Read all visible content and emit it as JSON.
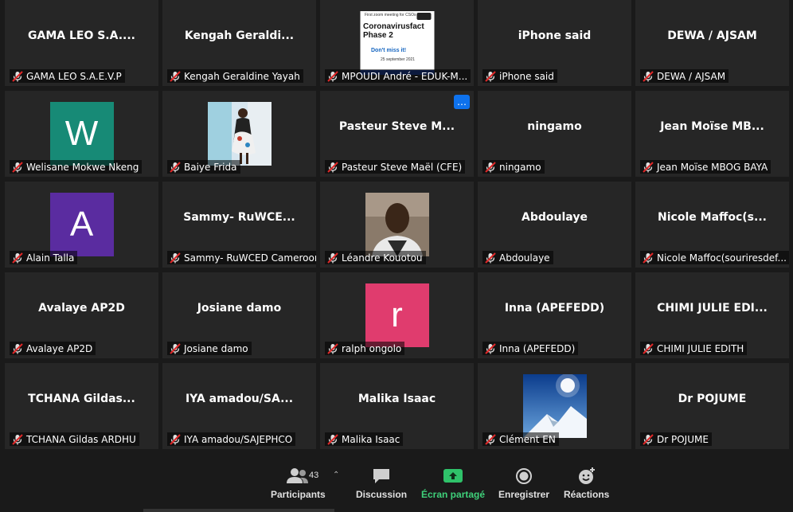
{
  "participants": [
    {
      "center": "GAMA LEO S.A....",
      "label": "GAMA LEO S.A.E.V.P",
      "kind": "name"
    },
    {
      "center": "Kengah Geraldi...",
      "label": "Kengah Geraldine Yayah",
      "kind": "name"
    },
    {
      "center": "",
      "label": "MPOUDI André - EDUK-M...",
      "kind": "shared"
    },
    {
      "center": "iPhone said",
      "label": "iPhone said",
      "kind": "name"
    },
    {
      "center": "DEWA / AJSAM",
      "label": "DEWA / AJSAM",
      "kind": "name"
    },
    {
      "center": "W",
      "label": "Welisane Mokwe Nkeng",
      "kind": "avatar",
      "color": "#178a76"
    },
    {
      "center": "",
      "label": "Baiye Frida",
      "kind": "photo-woman"
    },
    {
      "center": "Pasteur Steve M...",
      "label": "Pasteur Steve Maël (CFE)",
      "kind": "name",
      "more": true
    },
    {
      "center": "ningamo",
      "label": "ningamo",
      "kind": "name"
    },
    {
      "center": "Jean Moïse MB...",
      "label": "Jean Moïse MBOG BAYA",
      "kind": "name"
    },
    {
      "center": "A",
      "label": "Alain Talla",
      "kind": "avatar",
      "color": "#5a2ca0"
    },
    {
      "center": "Sammy- RuWCE...",
      "label": "Sammy- RuWCED Cameroon",
      "kind": "name"
    },
    {
      "center": "",
      "label": "Léandre Kouotou",
      "kind": "photo-man"
    },
    {
      "center": "Abdoulaye",
      "label": "Abdoulaye",
      "kind": "name"
    },
    {
      "center": "Nicole Maffoc(s...",
      "label": "Nicole Maffoc(souriresdef...",
      "kind": "name"
    },
    {
      "center": "Avalaye AP2D",
      "label": "Avalaye AP2D",
      "kind": "name"
    },
    {
      "center": "Josiane damo",
      "label": "Josiane damo",
      "kind": "name"
    },
    {
      "center": "r",
      "label": "ralph ongolo",
      "kind": "avatar",
      "color": "#e03c6e"
    },
    {
      "center": "Inna (APEFEDD)",
      "label": "Inna (APEFEDD)",
      "kind": "name"
    },
    {
      "center": "CHIMI JULIE EDI...",
      "label": "CHIMI JULIE EDITH",
      "kind": "name"
    },
    {
      "center": "TCHANA Gildas...",
      "label": "TCHANA Gildas ARDHU",
      "kind": "name"
    },
    {
      "center": "IYA amadou/SA...",
      "label": "IYA amadou/SAJEPHCO",
      "kind": "name"
    },
    {
      "center": "Malika Isaac",
      "label": "Malika Isaac",
      "kind": "name"
    },
    {
      "center": "",
      "label": "Clément EN",
      "kind": "photo-mountain"
    },
    {
      "center": "Dr POJUME",
      "label": "Dr POJUME",
      "kind": "name"
    }
  ],
  "shared_thumb": {
    "small": "First zoom meeting for CSOs",
    "title": "Coronavirusfact Phase 2",
    "sub": "Don't miss it!",
    "date": "25 september 2021"
  },
  "toolbar": {
    "participants_label": "Participants",
    "participants_count": "43",
    "discussion_label": "Discussion",
    "share_label": "Écran partagé",
    "record_label": "Enregistrer",
    "reactions_label": "Réactions"
  },
  "colors": {
    "share_green": "#3fd07a",
    "tile_bg": "#262626",
    "more_blue": "#0e72ed"
  }
}
